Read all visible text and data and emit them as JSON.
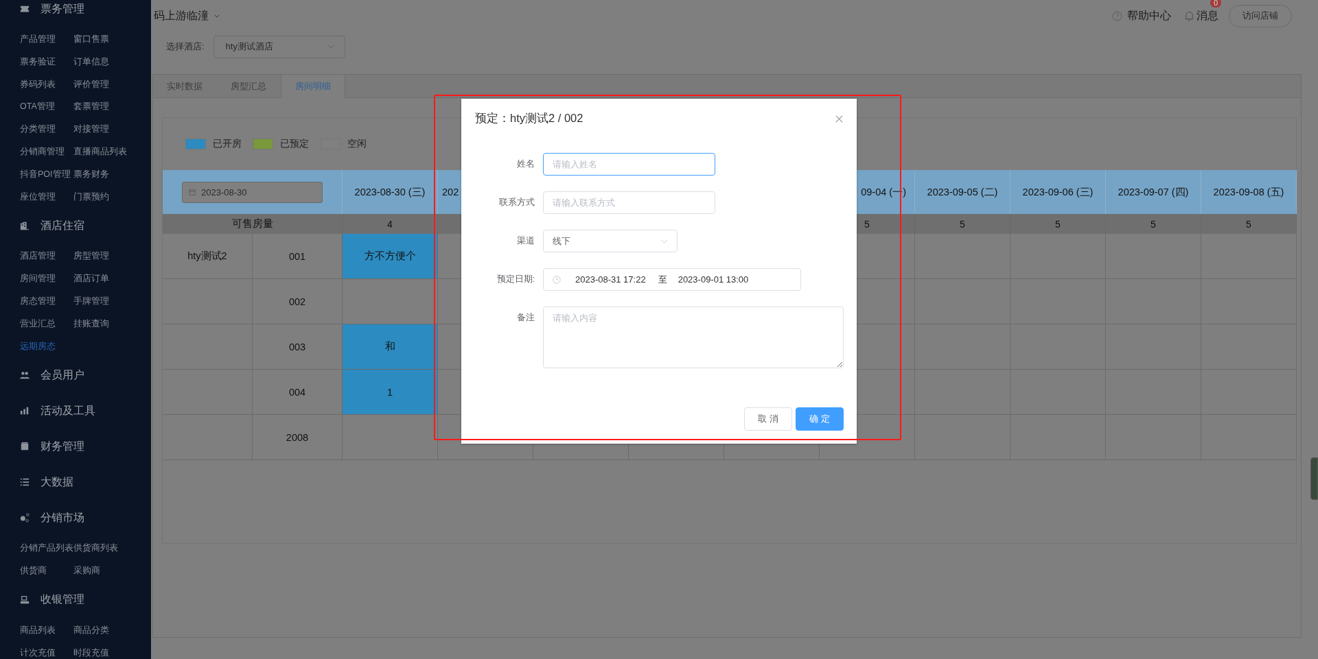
{
  "sidebar": {
    "groups": [
      {
        "title": "票务管理",
        "items": [
          {
            "label": "产品管理",
            "selected": false
          },
          {
            "label": "窗口售票",
            "selected": false
          },
          {
            "label": "票务验证",
            "selected": false
          },
          {
            "label": "订单信息",
            "selected": false
          },
          {
            "label": "券码列表",
            "selected": false
          },
          {
            "label": "评价管理",
            "selected": false
          },
          {
            "label": "OTA管理",
            "selected": false
          },
          {
            "label": "套票管理",
            "selected": false
          },
          {
            "label": "分类管理",
            "selected": false
          },
          {
            "label": "对接管理",
            "selected": false
          },
          {
            "label": "分销商管理",
            "selected": false
          },
          {
            "label": "直播商品列表",
            "selected": false
          },
          {
            "label": "抖音POI管理",
            "selected": false
          },
          {
            "label": "票务财务",
            "selected": false
          },
          {
            "label": "座位管理",
            "selected": false
          },
          {
            "label": "门票预约",
            "selected": false
          }
        ]
      },
      {
        "title": "酒店住宿",
        "items": [
          {
            "label": "酒店管理",
            "selected": false
          },
          {
            "label": "房型管理",
            "selected": false
          },
          {
            "label": "房间管理",
            "selected": false
          },
          {
            "label": "酒店订单",
            "selected": false
          },
          {
            "label": "房态管理",
            "selected": false
          },
          {
            "label": "手牌管理",
            "selected": false
          },
          {
            "label": "营业汇总",
            "selected": false
          },
          {
            "label": "挂账查询",
            "selected": false
          },
          {
            "label": "远期房态",
            "selected": true
          }
        ]
      },
      {
        "title": "会员用户"
      },
      {
        "title": "活动及工具"
      },
      {
        "title": "财务管理"
      },
      {
        "title": "大数据"
      },
      {
        "title": "分销市场",
        "items": [
          {
            "label": "分销产品列表",
            "selected": false
          },
          {
            "label": "供货商列表",
            "selected": false
          },
          {
            "label": "供货商",
            "selected": false
          },
          {
            "label": "采购商",
            "selected": false
          }
        ]
      },
      {
        "title": "收银管理",
        "items": [
          {
            "label": "商品列表",
            "selected": false
          },
          {
            "label": "商品分类",
            "selected": false
          },
          {
            "label": "计次充值",
            "selected": false
          },
          {
            "label": "时段充值",
            "selected": false
          }
        ]
      }
    ]
  },
  "header": {
    "app_title": "码上游临潼",
    "help": "帮助中心",
    "messages": "消息",
    "message_count": "0",
    "visit_store": "访问店铺"
  },
  "hotel_filter": {
    "label": "选择酒店:",
    "value": "hty测试酒店"
  },
  "tabs": [
    {
      "label": "实时数据",
      "selected": false
    },
    {
      "label": "房型汇总",
      "selected": false
    },
    {
      "label": "房间明细",
      "selected": true
    }
  ],
  "legend": [
    {
      "label": "已开房",
      "color": "#2c8bc0"
    },
    {
      "label": "已预定",
      "color": "#7a983c"
    },
    {
      "label": "空闲",
      "color": "#808080"
    }
  ],
  "room_table": {
    "date_filter": "2023-08-30",
    "count_label": "可售房量",
    "columns": [
      {
        "label": "2023-08-30 (三)",
        "count": "4"
      },
      {
        "label": "202"
      },
      {},
      {},
      {},
      {
        "label": "09-04 (一)",
        "count": "5"
      },
      {
        "label": "2023-09-05 (二)",
        "count": "5"
      },
      {
        "label": "2023-09-06 (三)",
        "count": "5"
      },
      {
        "label": "2023-09-07 (四)",
        "count": "5"
      },
      {
        "label": "2023-09-08 (五)",
        "count": "5"
      }
    ],
    "rows": [
      {
        "room_type": "hty测试2",
        "room": "001",
        "cells": [
          {
            "guest": "方不方便个",
            "kind": "open"
          }
        ]
      },
      {
        "room": "002",
        "cells": []
      },
      {
        "room": "003",
        "cells": [
          {
            "guest": "和",
            "kind": "open"
          }
        ]
      },
      {
        "room": "004",
        "cells": [
          {
            "guest": "1",
            "kind": "open"
          }
        ]
      },
      {
        "room": "2008",
        "cells": []
      }
    ]
  },
  "dialog": {
    "title": "预定：hty测试2 / 002",
    "fields": [
      {
        "kind": "text",
        "label": "姓名",
        "placeholder": "请输入姓名",
        "focused": true
      },
      {
        "kind": "text",
        "label": "联系方式",
        "placeholder": "请输入联系方式",
        "focused": false
      },
      {
        "kind": "select",
        "label": "渠道",
        "value": "线下"
      },
      {
        "kind": "daterange",
        "label": "预定日期:",
        "start": "2023-08-31 17:22",
        "separator": "至",
        "end": "2023-09-01 13:00"
      },
      {
        "kind": "textarea",
        "label": "备注",
        "placeholder": "请输入内容"
      }
    ],
    "buttons": [
      {
        "label": "取 消",
        "primary": false
      },
      {
        "label": "确 定",
        "primary": true
      }
    ]
  }
}
